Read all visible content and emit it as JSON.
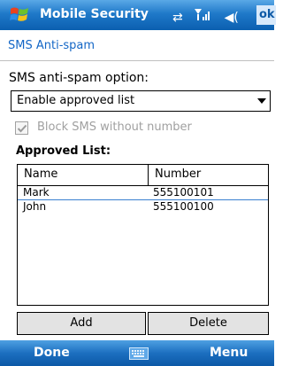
{
  "title_bar": {
    "app_title": "Mobile Security",
    "ok_label": "ok",
    "icons": [
      "windows-start-icon",
      "sync-icon",
      "signal-icon",
      "volume-icon"
    ]
  },
  "page": {
    "title": "SMS Anti-spam",
    "option_label": "SMS anti-spam option:",
    "dropdown_value": "Enable approved list",
    "checkbox_label": "Block SMS without number",
    "checkbox_checked": true,
    "approved_label": "Approved List:"
  },
  "list": {
    "columns": [
      "Name",
      "Number"
    ],
    "rows": [
      {
        "name": "Mark",
        "number": "555100101"
      },
      {
        "name": "John",
        "number": "555100100"
      }
    ]
  },
  "buttons": {
    "add": "Add",
    "delete": "Delete"
  },
  "softkeys": {
    "left": "Done",
    "right": "Menu"
  },
  "colors": {
    "title_blue": "#1f79c9",
    "accent_blue": "#1366c6",
    "disabled_gray": "#a0a0a0"
  }
}
